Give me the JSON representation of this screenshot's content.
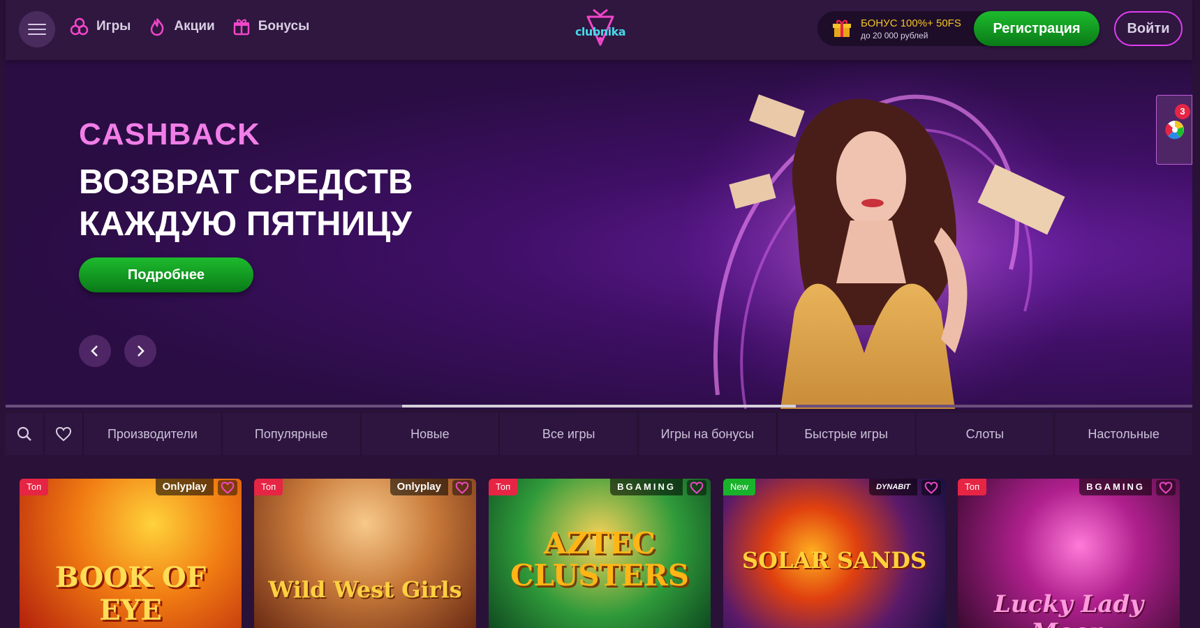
{
  "header": {
    "nav": [
      {
        "label": "Игры",
        "icon": "cherries-icon"
      },
      {
        "label": "Акции",
        "icon": "flame-icon"
      },
      {
        "label": "Бонусы",
        "icon": "gift-icon"
      }
    ],
    "logo_text": "clubnika",
    "bonus_title": "БОНУС 100%+ 50FS",
    "bonus_sub": "до 20 000 рублей",
    "register_label": "Регистрация",
    "login_label": "Войти"
  },
  "hero": {
    "title1": "CASHBACK",
    "title2": "ВОЗВРАТ СРЕДСТВ\nКАЖДУЮ ПЯТНИЦУ",
    "cta_label": "Подробнее"
  },
  "side_widget": {
    "badge": "3"
  },
  "categories": [
    "Производители",
    "Популярные",
    "Новые",
    "Все игры",
    "Игры на бонусы",
    "Быстрые игры",
    "Слоты",
    "Настольные"
  ],
  "games": [
    {
      "tag": "Топ",
      "provider": "Onlyplay",
      "title": "BOOK OF EYE"
    },
    {
      "tag": "Топ",
      "provider": "Onlyplay",
      "title": "Wild West Girls"
    },
    {
      "tag": "Топ",
      "provider": "BGAMING",
      "title": "AZTEC CLUSTERS"
    },
    {
      "tag": "New",
      "provider": "DYNABIT",
      "title": "SOLAR SANDS"
    },
    {
      "tag": "Топ",
      "provider": "BGAMING",
      "title": "Lucky Lady Moon"
    }
  ],
  "colors": {
    "accent_green": "#1dbb2d",
    "accent_pink": "#f27ee8",
    "tag_top": "#e62545",
    "tag_new": "#18b32b",
    "bonus_gold": "#f4c524"
  }
}
